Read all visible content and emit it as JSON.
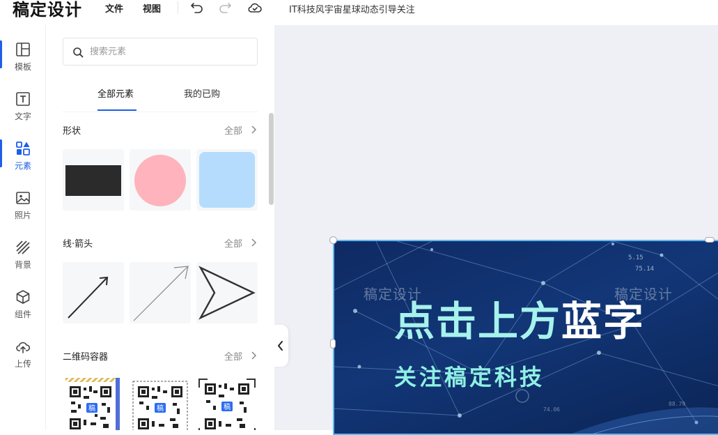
{
  "app": {
    "logo": "稿定设计"
  },
  "topbar": {
    "menu": [
      "文件",
      "视图"
    ],
    "undo_icon": "undo-icon",
    "redo_icon": "redo-icon",
    "cloud_icon": "cloud-check-icon",
    "doc_title": "IT科技风宇宙星球动态引导关注"
  },
  "rail": {
    "items": [
      {
        "label": "模板",
        "icon": "layout-icon",
        "active": false
      },
      {
        "label": "文字",
        "icon": "text-icon",
        "active": false
      },
      {
        "label": "元素",
        "icon": "shapes-icon",
        "active": true
      },
      {
        "label": "照片",
        "icon": "image-icon",
        "active": false
      },
      {
        "label": "背景",
        "icon": "stripes-icon",
        "active": false
      },
      {
        "label": "组件",
        "icon": "cube-icon",
        "active": false
      },
      {
        "label": "上传",
        "icon": "upload-cloud-icon",
        "active": false
      }
    ]
  },
  "panel": {
    "search_placeholder": "搜索元素",
    "tabs": [
      "全部元素",
      "我的已购"
    ],
    "active_tab": 0,
    "sections": [
      {
        "title": "形状",
        "all_label": "全部",
        "items": [
          "dark-rectangle",
          "pink-circle",
          "light-blue-rounded-square"
        ]
      },
      {
        "title": "线·箭头",
        "all_label": "全部",
        "items": [
          "arrow-line",
          "thin-gray-arrow",
          "outline-arrowhead"
        ]
      },
      {
        "title": "二维码容器",
        "all_label": "全部",
        "items": [
          "qr-frame-striped",
          "qr-frame-dashed",
          "qr-frame-corners"
        ]
      }
    ],
    "qr_badge": "稿"
  },
  "canvas": {
    "watermark": "稿定设计",
    "headline_part1": "点击上方",
    "headline_part2": "蓝字",
    "subline": "关注稿定科技",
    "numbers": [
      "5.15",
      "75.14",
      "74.06",
      "88.79"
    ],
    "colors": {
      "background": "#123677",
      "headline_accent": "#a6f2ec",
      "subline": "#8ff0e3",
      "selection": "#5fb7f2"
    }
  },
  "colors": {
    "accent": "#1f5ee8",
    "workspace": "#eef0f5"
  }
}
